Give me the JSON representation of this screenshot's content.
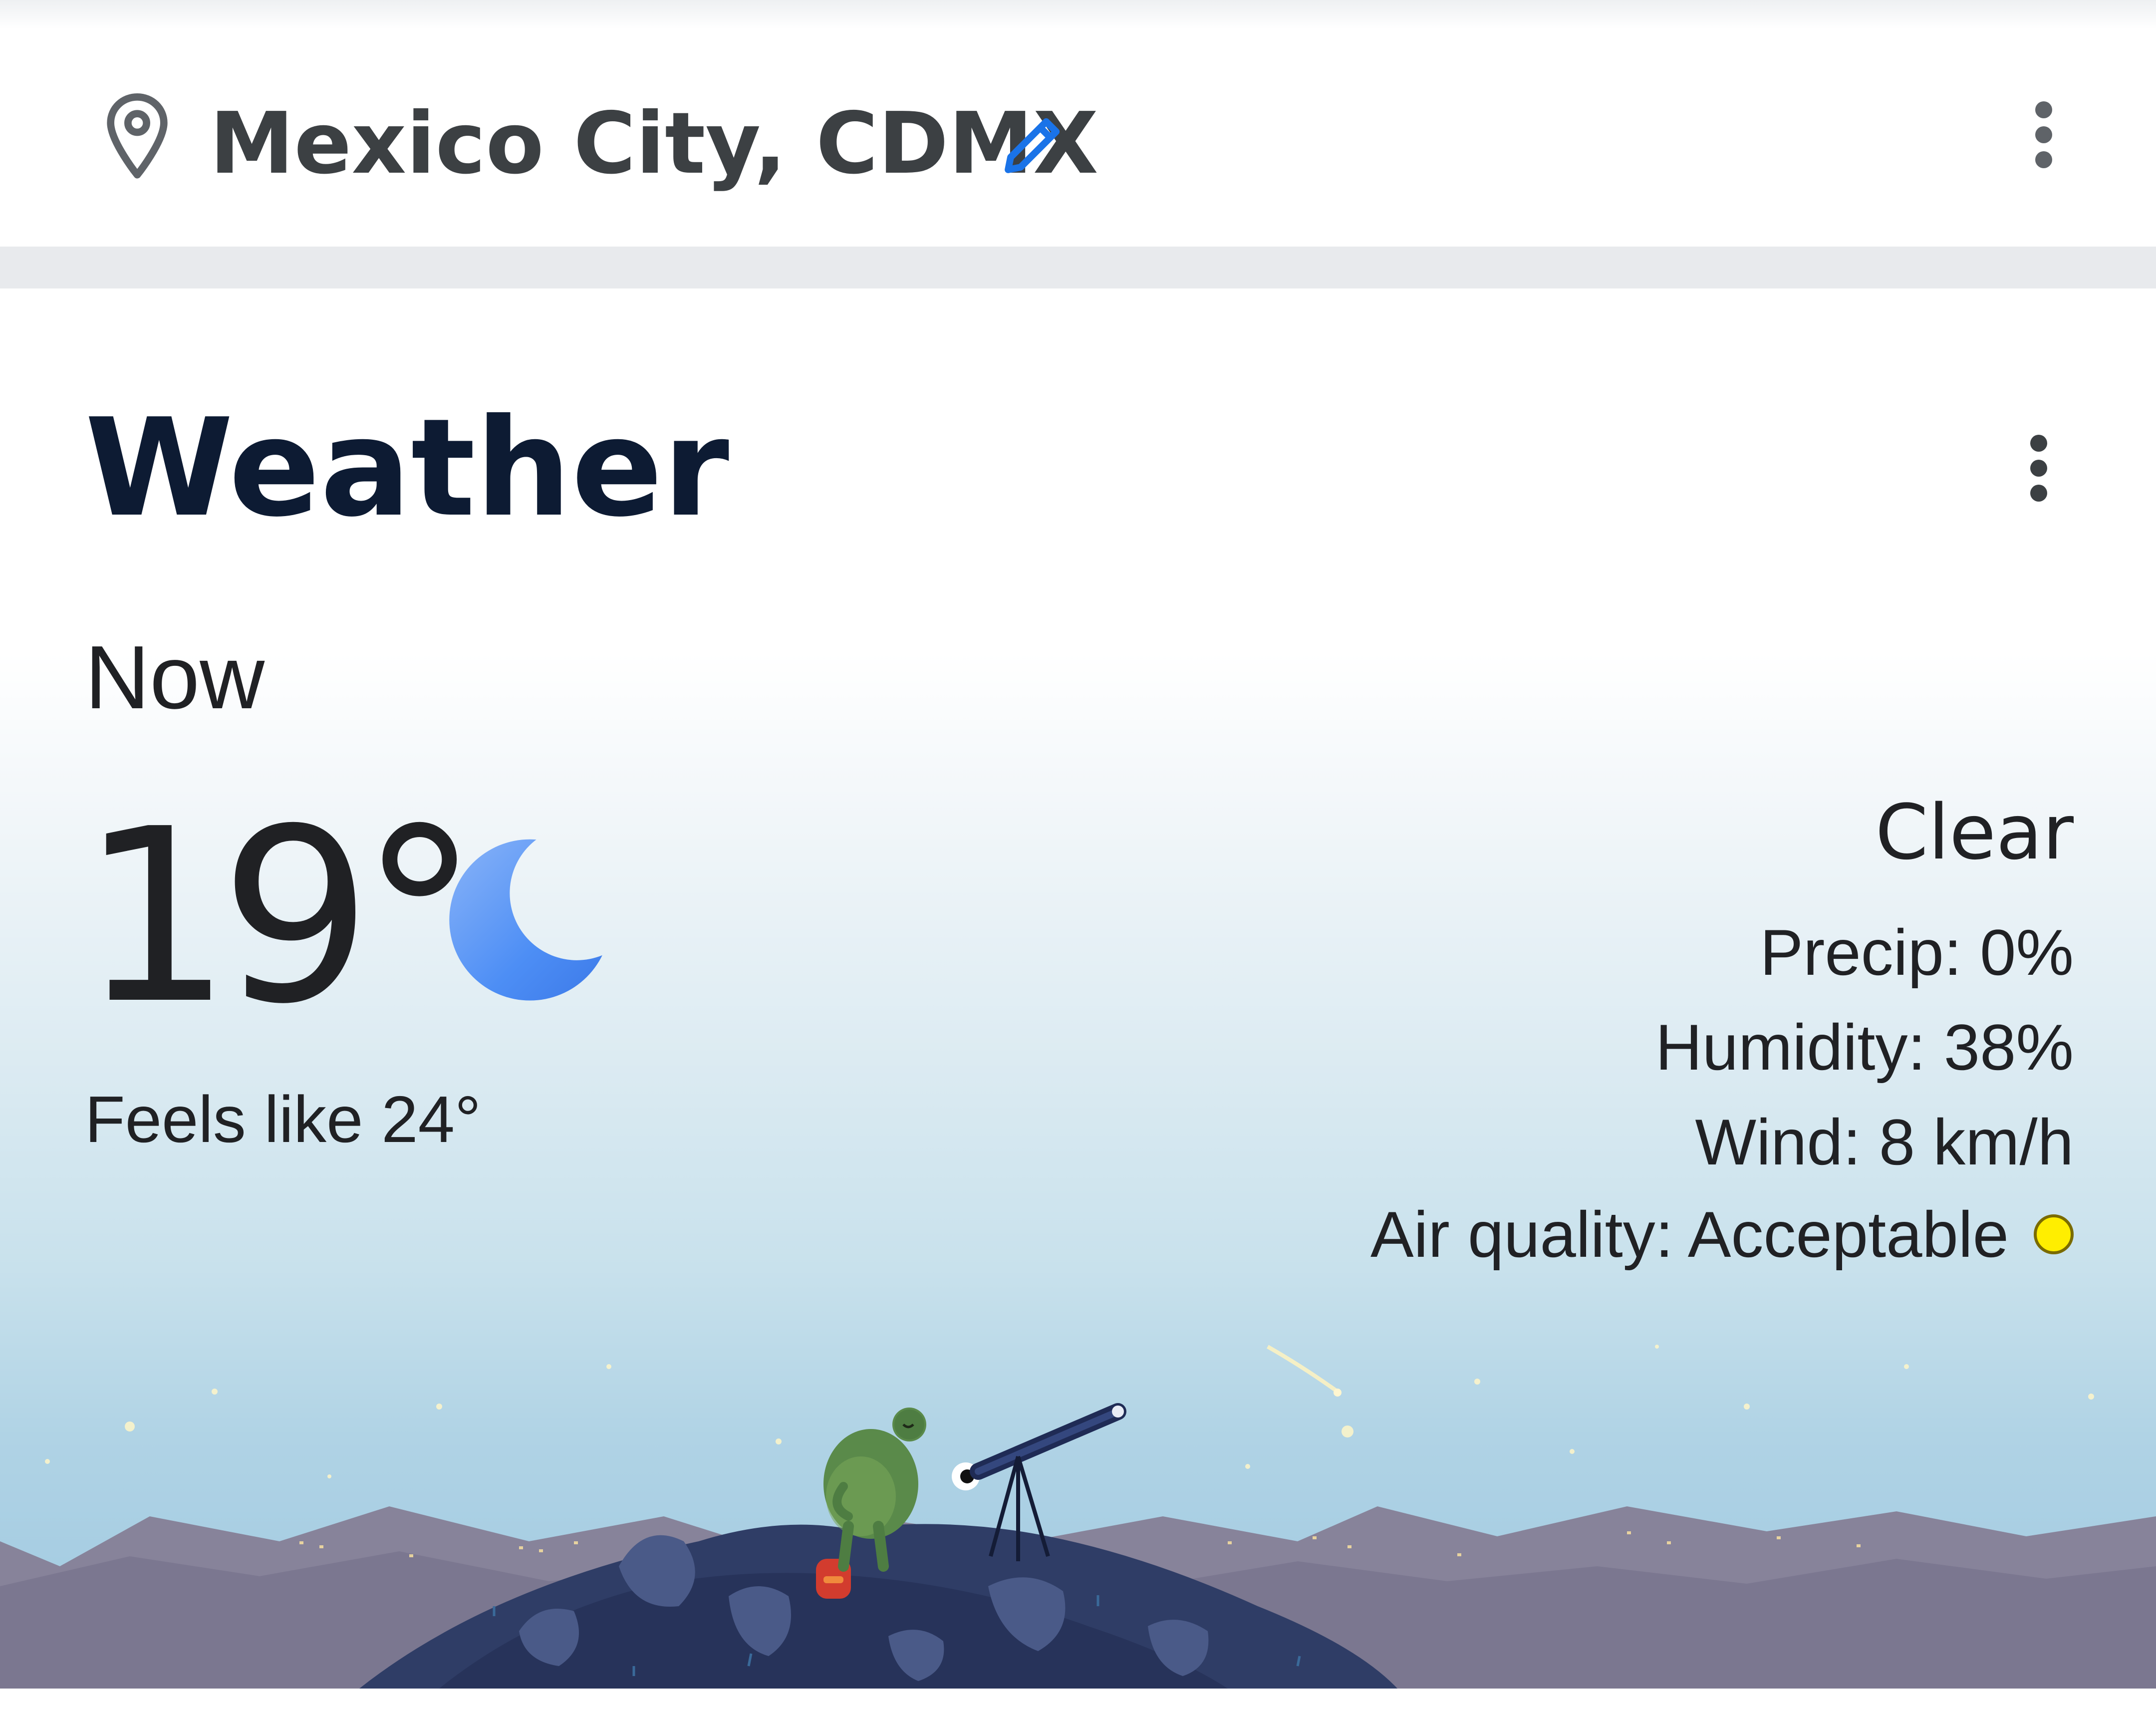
{
  "location_bar": {
    "location": "Mexico City, CDMX",
    "icons": {
      "location": "map-pin-icon",
      "edit": "pencil-icon",
      "menu": "more-vert-icon"
    },
    "edit_color": "#1a73e8"
  },
  "weather_card": {
    "title": "Weather",
    "menu_icon": "more-vert-icon",
    "now_label": "Now",
    "temperature": "19°",
    "condition_icon": "moon-icon",
    "feels_like": "Feels like 24°",
    "condition": "Clear",
    "details": {
      "precip": "Precip: 0%",
      "humidity": "Humidity: 38%",
      "wind": "Wind: 8 km/h",
      "air_quality": "Air quality: Acceptable"
    },
    "air_quality_color": "#ffee00",
    "moon_color": "#4285f4",
    "illustration": "frog-with-telescope-night-scene"
  }
}
